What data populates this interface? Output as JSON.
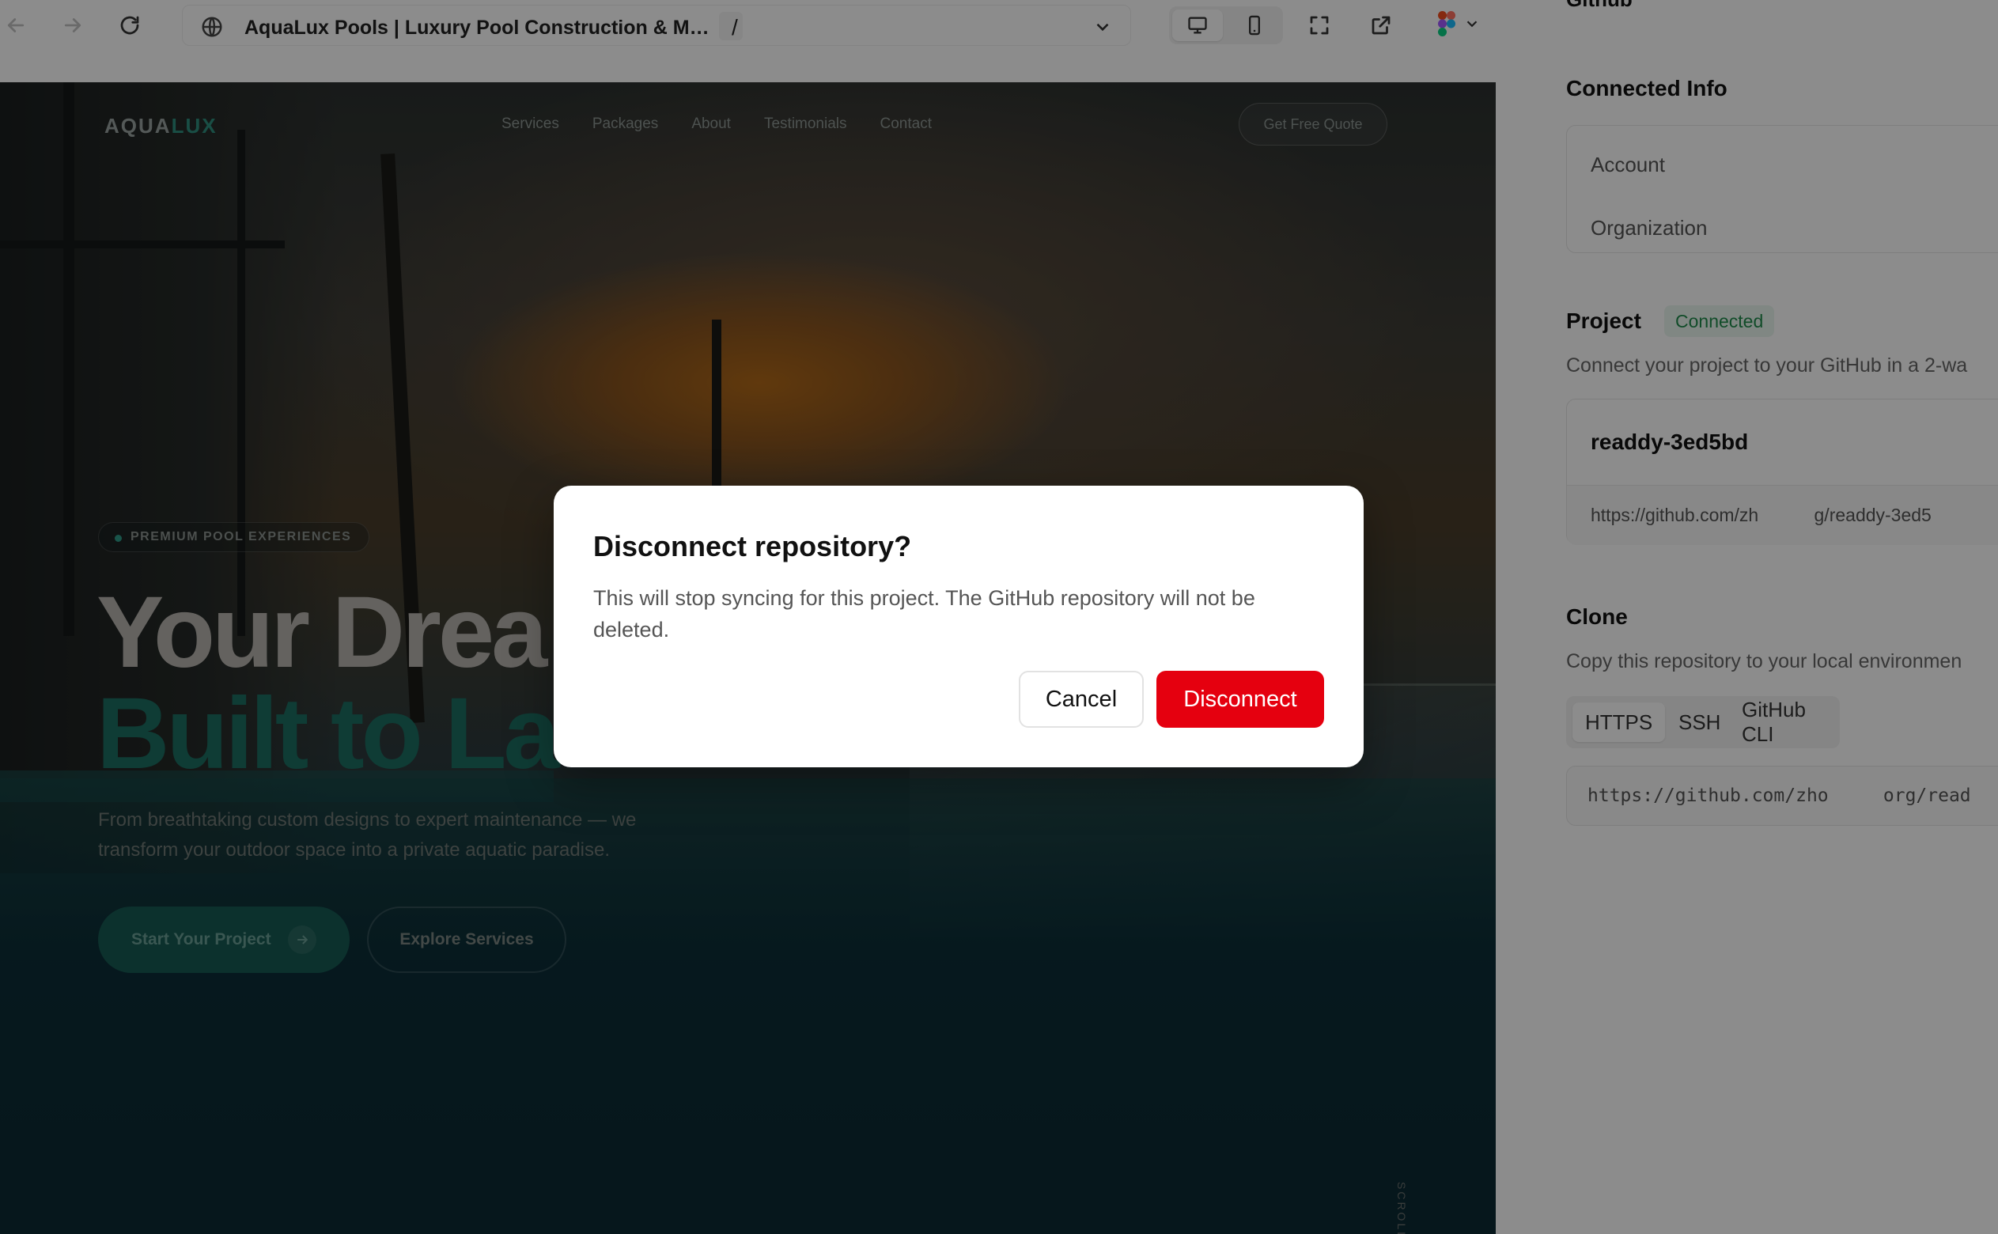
{
  "browser": {
    "page_title": "AquaLux Pools | Luxury Pool Construction & Mai...",
    "path": "/"
  },
  "panel": {
    "header": "Github",
    "connected_info": {
      "title": "Connected Info",
      "account_label": "Account",
      "organization_label": "Organization"
    },
    "project": {
      "title": "Project",
      "status": "Connected",
      "description": "Connect your project to your GitHub in a 2-wa",
      "repo_name": "readdy-3ed5bd",
      "repo_url": "https://github.com/zh           g/readdy-3ed5"
    },
    "clone": {
      "title": "Clone",
      "description": "Copy this repository to your local environmen",
      "tabs": [
        "HTTPS",
        "SSH",
        "GitHub CLI"
      ],
      "url": "https://github.com/zho     org/read"
    }
  },
  "site": {
    "logo_part1": "AQUA",
    "logo_part2": "LUX",
    "nav": [
      "Services",
      "Packages",
      "About",
      "Testimonials",
      "Contact"
    ],
    "quote_button": "Get Free Quote",
    "badge": "PREMIUM POOL EXPERIENCES",
    "hero_line1": "Your Drea",
    "hero_line2": "Built to La",
    "subtitle": "From breathtaking custom designs to expert maintenance — we transform your outdoor space into a private aquatic paradise.",
    "cta_primary": "Start Your Project",
    "cta_secondary": "Explore Services",
    "scroll": "SCROLL"
  },
  "dialog": {
    "title": "Disconnect repository?",
    "body": "This will stop syncing for this project. The GitHub repository will not be deleted.",
    "cancel": "Cancel",
    "confirm": "Disconnect"
  },
  "colors": {
    "primary_danger": "#e5000f",
    "connected_green": "#1f8a4c",
    "brand_teal": "#2f8f7f"
  },
  "icons": {
    "back": "arrow-left-icon",
    "forward": "arrow-right-icon",
    "reload": "reload-icon",
    "globe": "globe-icon",
    "desktop": "desktop-icon",
    "mobile": "mobile-icon",
    "fullscreen": "fullscreen-icon",
    "external": "external-link-icon",
    "figma": "figma-icon"
  }
}
